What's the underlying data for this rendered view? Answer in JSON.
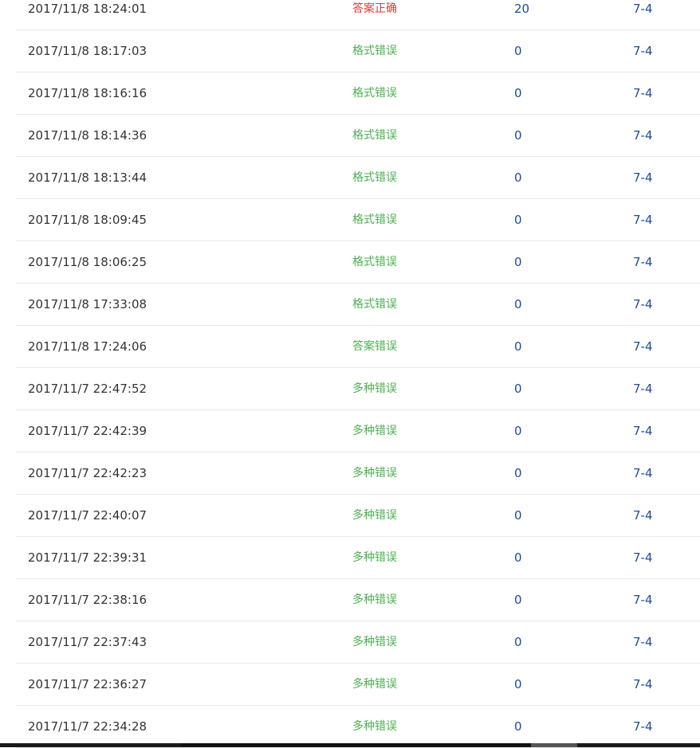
{
  "submissions": [
    {
      "time": "2017/11/8 18:24:01",
      "status": "答案正确",
      "status_color": "#e53935",
      "score": "20",
      "problem": "7-4"
    },
    {
      "time": "2017/11/8 18:17:03",
      "status": "格式错误",
      "status_color": "#4caf50",
      "score": "0",
      "problem": "7-4"
    },
    {
      "time": "2017/11/8 18:16:16",
      "status": "格式错误",
      "status_color": "#4caf50",
      "score": "0",
      "problem": "7-4"
    },
    {
      "time": "2017/11/8 18:14:36",
      "status": "格式错误",
      "status_color": "#4caf50",
      "score": "0",
      "problem": "7-4"
    },
    {
      "time": "2017/11/8 18:13:44",
      "status": "格式错误",
      "status_color": "#4caf50",
      "score": "0",
      "problem": "7-4"
    },
    {
      "time": "2017/11/8 18:09:45",
      "status": "格式错误",
      "status_color": "#4caf50",
      "score": "0",
      "problem": "7-4"
    },
    {
      "time": "2017/11/8 18:06:25",
      "status": "格式错误",
      "status_color": "#4caf50",
      "score": "0",
      "problem": "7-4"
    },
    {
      "time": "2017/11/8 17:33:08",
      "status": "格式错误",
      "status_color": "#4caf50",
      "score": "0",
      "problem": "7-4"
    },
    {
      "time": "2017/11/8 17:24:06",
      "status": "答案错误",
      "status_color": "#4caf50",
      "score": "0",
      "problem": "7-4"
    },
    {
      "time": "2017/11/7 22:47:52",
      "status": "多种错误",
      "status_color": "#4caf50",
      "score": "0",
      "problem": "7-4"
    },
    {
      "time": "2017/11/7 22:42:39",
      "status": "多种错误",
      "status_color": "#4caf50",
      "score": "0",
      "problem": "7-4"
    },
    {
      "time": "2017/11/7 22:42:23",
      "status": "多种错误",
      "status_color": "#4caf50",
      "score": "0",
      "problem": "7-4"
    },
    {
      "time": "2017/11/7 22:40:07",
      "status": "多种错误",
      "status_color": "#4caf50",
      "score": "0",
      "problem": "7-4"
    },
    {
      "time": "2017/11/7 22:39:31",
      "status": "多种错误",
      "status_color": "#4caf50",
      "score": "0",
      "problem": "7-4"
    },
    {
      "time": "2017/11/7 22:38:16",
      "status": "多种错误",
      "status_color": "#4caf50",
      "score": "0",
      "problem": "7-4"
    },
    {
      "time": "2017/11/7 22:37:43",
      "status": "多种错误",
      "status_color": "#4caf50",
      "score": "0",
      "problem": "7-4"
    },
    {
      "time": "2017/11/7 22:36:27",
      "status": "多种错误",
      "status_color": "#4caf50",
      "score": "0",
      "problem": "7-4"
    },
    {
      "time": "2017/11/7 22:34:28",
      "status": "多种错误",
      "status_color": "#4caf50",
      "score": "0",
      "problem": "7-4"
    }
  ],
  "colors": {
    "link": "#1d4a9b",
    "accepted": "#e53935",
    "error": "#4caf50",
    "text": "#333333",
    "divider": "#e8e8e8"
  }
}
